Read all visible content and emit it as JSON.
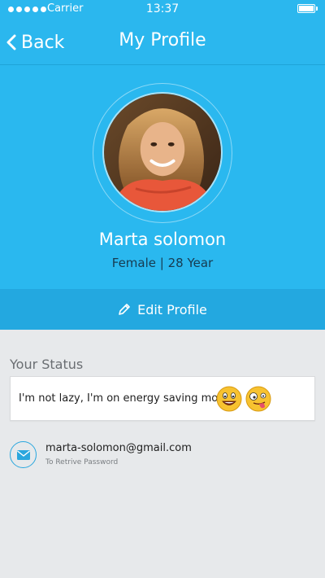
{
  "status_bar": {
    "carrier": "Carrier",
    "time": "13:37",
    "signal_bars": 5,
    "battery_level": 1.0
  },
  "nav": {
    "back_label": "Back",
    "title": "My Profile"
  },
  "profile": {
    "name": "Marta solomon",
    "meta": "Female | 28 Year"
  },
  "edit": {
    "label": "Edit Profile",
    "icon": "pencil-icon"
  },
  "status_section": {
    "title": "Your Status",
    "text": "I'm not lazy, I'm on energy saving mode.",
    "emojis": [
      "grinning-emoji",
      "tongue-out-emoji"
    ]
  },
  "email": {
    "address": "marta-solomon@gmail.com",
    "hint": "To Retrive Password",
    "icon": "mail-icon"
  },
  "colors": {
    "primary": "#2ab8ef",
    "edit_bar": "#23a8e0",
    "background": "#e7e9eb"
  }
}
